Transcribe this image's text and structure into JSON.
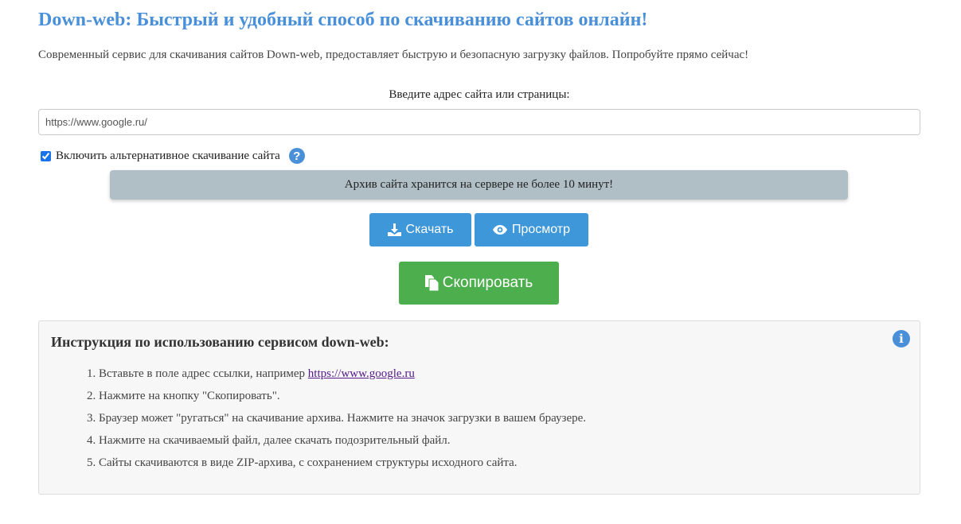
{
  "header": {
    "title": "Down-web: Быстрый и удобный способ по скачиванию сайтов онлайн!",
    "subtitle": "Современный сервис для скачивания сайтов Down-web, предоставляет быструю и безопасную загрузку файлов. Попробуйте прямо сейчас!"
  },
  "form": {
    "url_label": "Введите адрес сайта или страницы:",
    "url_value": "https://www.google.ru/",
    "alt_download_label": "Включить альтернативное скачивание сайта",
    "alt_download_checked": true,
    "help_icon": "question-circle-icon",
    "help_glyph": "?",
    "notice": "Архив сайта хранится на сервере не более 10 минут!"
  },
  "buttons": {
    "download_label": "Скачать",
    "download_icon": "download-icon",
    "view_label": "Просмотр",
    "view_icon": "eye-icon",
    "copy_label": "Скопировать",
    "copy_icon": "copy-icon"
  },
  "instructions": {
    "title": "Инструкция по использованию сервисом down-web:",
    "info_icon": "info-circle-icon",
    "info_glyph": "i",
    "step1_text": "Вставьте в поле адрес ссылки, например ",
    "step1_link": "https://www.google.ru",
    "step2": "Нажмите на кнопку \"Скопировать\".",
    "step3": "Браузер может \"ругаться\" на скачивание архива. Нажмите на значок загрузки в вашем браузере.",
    "step4": "Нажмите на скачиваемый файл, далее скачать подозрительный файл.",
    "step5": "Сайты скачиваются в виде ZIP-архива, с сохранением структуры исходного сайта."
  },
  "colors": {
    "title": "#4a90d9",
    "primary_button": "#3d97d9",
    "copy_button": "#4cae4c",
    "notice_bg": "#b0bec5",
    "panel_bg": "#f7f7f7"
  }
}
